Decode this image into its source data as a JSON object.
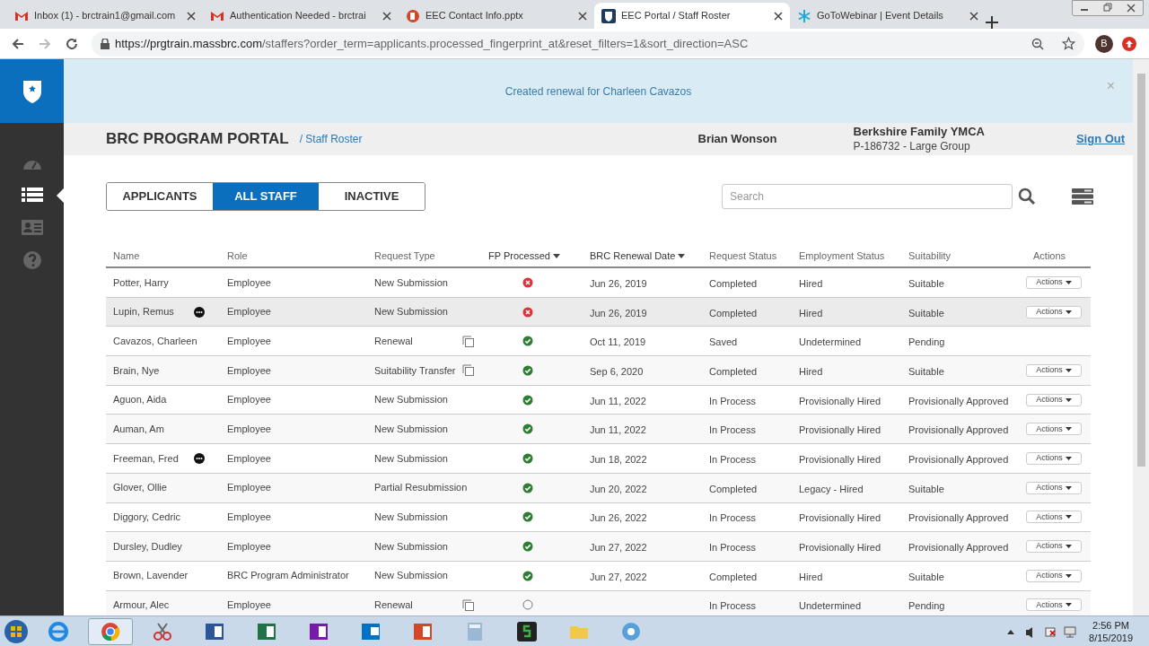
{
  "browser_tabs": [
    {
      "kind": "mail",
      "label": "Inbox (1) - brctrain1@gmail.com",
      "selected": false
    },
    {
      "kind": "mail",
      "label": "Authentication Needed - brctrai",
      "selected": false
    },
    {
      "kind": "slides",
      "label": "EEC Contact Info.pptx",
      "selected": false
    },
    {
      "kind": "shield",
      "label": "EEC Portal / Staff Roster",
      "selected": true
    },
    {
      "kind": "snowflake",
      "label": "GoToWebinar | Event Details",
      "selected": false
    }
  ],
  "address_bar": {
    "host": "https://prgtrain.massbrc.com",
    "path": "/staffers?order_term=applicants.processed_fingerprint_at&reset_filters=1&sort_direction=ASC",
    "avatar": "B"
  },
  "banner": {
    "message": "Created renewal for Charleen Cavazos",
    "close": "×"
  },
  "header": {
    "title": "BRC PROGRAM PORTAL",
    "breadcrumb": "/ Staff Roster",
    "user": "Brian Wonson",
    "org_name": "Berkshire Family YMCA",
    "org_detail": "P-186732 - Large Group",
    "sign_out": "Sign Out"
  },
  "sidebar": {
    "items": [
      {
        "kind": "gauge",
        "selected": false
      },
      {
        "kind": "list",
        "selected": true
      },
      {
        "kind": "card",
        "selected": false
      },
      {
        "kind": "help",
        "selected": false
      }
    ]
  },
  "view_tabs": [
    {
      "label": "APPLICANTS",
      "selected": false
    },
    {
      "label": "ALL STAFF",
      "selected": true
    },
    {
      "label": "INACTIVE",
      "selected": false
    }
  ],
  "search": {
    "placeholder": "Search"
  },
  "table": {
    "columns": [
      {
        "label": "Name",
        "sorted": false
      },
      {
        "label": "Role",
        "sorted": false
      },
      {
        "label": "Request Type",
        "sorted": false
      },
      {
        "label": "FP Processed",
        "sorted": true
      },
      {
        "label": "BRC Renewal Date",
        "sorted": true
      },
      {
        "label": "Request Status",
        "sorted": false
      },
      {
        "label": "Employment Status",
        "sorted": false
      },
      {
        "label": "Suitability",
        "sorted": false
      },
      {
        "label": "Actions",
        "sorted": false
      }
    ],
    "rows": [
      {
        "name": "Potter, Harry",
        "badge": false,
        "role": "Employee",
        "request_type": "New Submission",
        "copy": false,
        "kind": "failed",
        "date": "Jun 26, 2019",
        "request_status": "Completed",
        "employment_status": "Hired",
        "suitability": "Suitable",
        "actions": "Actions",
        "hovered": false
      },
      {
        "name": "Lupin, Remus",
        "badge": true,
        "role": "Employee",
        "request_type": "New Submission",
        "copy": false,
        "kind": "failed",
        "date": "Jun 26, 2019",
        "request_status": "Completed",
        "employment_status": "Hired",
        "suitability": "Suitable",
        "actions": "Actions",
        "hovered": true
      },
      {
        "name": "Cavazos, Charleen",
        "badge": false,
        "role": "Employee",
        "request_type": "Renewal",
        "copy": true,
        "kind": "done",
        "date": "Oct 11, 2019",
        "request_status": "Saved",
        "employment_status": "Undetermined",
        "suitability": "Pending",
        "hovered": false
      },
      {
        "name": "Brain, Nye",
        "badge": false,
        "role": "Employee",
        "request_type": "Suitability Transfer",
        "copy": true,
        "kind": "done",
        "date": "Sep 6, 2020",
        "request_status": "Completed",
        "employment_status": "Hired",
        "suitability": "Suitable",
        "actions": "Actions",
        "hovered": false
      },
      {
        "name": "Aguon, Aida",
        "badge": false,
        "role": "Employee",
        "request_type": "New Submission",
        "copy": false,
        "kind": "done",
        "date": "Jun 11, 2022",
        "request_status": "In Process",
        "employment_status": "Provisionally Hired",
        "suitability": "Provisionally Approved",
        "actions": "Actions",
        "hovered": false
      },
      {
        "name": "Auman, Am",
        "badge": false,
        "role": "Employee",
        "request_type": "New Submission",
        "copy": false,
        "kind": "done",
        "date": "Jun 11, 2022",
        "request_status": "In Process",
        "employment_status": "Provisionally Hired",
        "suitability": "Provisionally Approved",
        "actions": "Actions",
        "hovered": false
      },
      {
        "name": "Freeman, Fred",
        "badge": true,
        "role": "Employee",
        "request_type": "New Submission",
        "copy": false,
        "kind": "done",
        "date": "Jun 18, 2022",
        "request_status": "In Process",
        "employment_status": "Provisionally Hired",
        "suitability": "Provisionally Approved",
        "actions": "Actions",
        "hovered": false
      },
      {
        "name": "Glover, Ollie",
        "badge": false,
        "role": "Employee",
        "request_type": "Partial Resubmission",
        "copy": false,
        "kind": "done",
        "date": "Jun 20, 2022",
        "request_status": "Completed",
        "employment_status": "Legacy - Hired",
        "suitability": "Suitable",
        "actions": "Actions",
        "hovered": false
      },
      {
        "name": "Diggory, Cedric",
        "badge": false,
        "role": "Employee",
        "request_type": "New Submission",
        "copy": false,
        "kind": "done",
        "date": "Jun 26, 2022",
        "request_status": "In Process",
        "employment_status": "Provisionally Hired",
        "suitability": "Provisionally Approved",
        "actions": "Actions",
        "hovered": false
      },
      {
        "name": "Dursley, Dudley",
        "badge": false,
        "role": "Employee",
        "request_type": "New Submission",
        "copy": false,
        "kind": "done",
        "date": "Jun 27, 2022",
        "request_status": "In Process",
        "employment_status": "Provisionally Hired",
        "suitability": "Provisionally Approved",
        "actions": "Actions",
        "hovered": false
      },
      {
        "name": "Brown, Lavender",
        "badge": false,
        "role": "BRC Program Administrator",
        "request_type": "New Submission",
        "copy": false,
        "kind": "done",
        "date": "Jun 27, 2022",
        "request_status": "Completed",
        "employment_status": "Hired",
        "suitability": "Suitable",
        "actions": "Actions",
        "hovered": false
      },
      {
        "name": "Armour, Alec",
        "badge": false,
        "role": "Employee",
        "request_type": "Renewal",
        "copy": true,
        "kind": "pending",
        "request_status": "In Process",
        "employment_status": "Undetermined",
        "suitability": "Pending",
        "actions": "Actions",
        "hovered": false
      }
    ]
  },
  "taskbar": {
    "time": "2:56 PM",
    "date": "8/15/2019"
  }
}
